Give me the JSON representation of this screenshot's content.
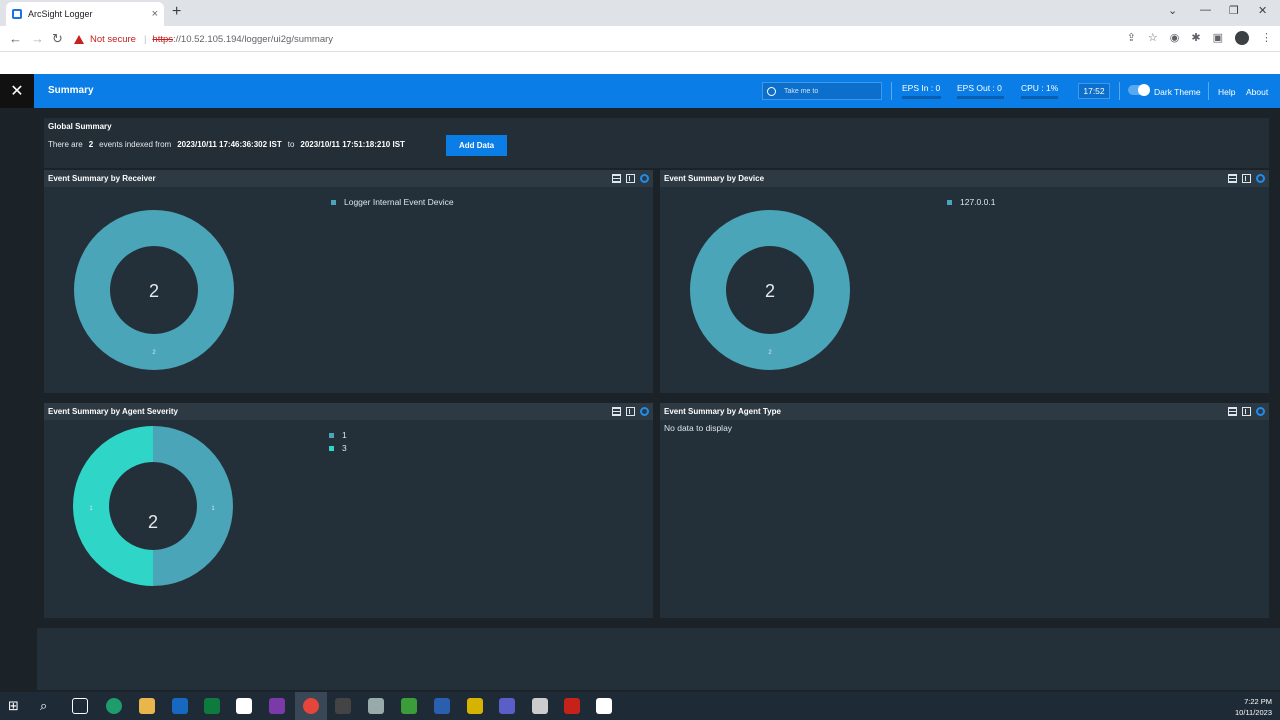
{
  "browser": {
    "tab_title": "ArcSight Logger",
    "tab_close": "×",
    "new_tab": "+",
    "security_label": "Not secure",
    "url_scheme": "https",
    "url_rest": "://10.52.105.194/logger/ui2g/summary"
  },
  "header": {
    "logo_glyph": "✕",
    "title": "Summary",
    "search_placeholder": "Take me to",
    "eps_in": "EPS In : 0",
    "eps_out": "EPS Out : 0",
    "cpu": "CPU : 1%",
    "time": "17:52",
    "theme_label": "Dark Theme",
    "help": "Help",
    "about": "About"
  },
  "global_summary": {
    "title": "Global Summary",
    "prefix": "There are",
    "count": "2",
    "middle": "events indexed from",
    "from": "2023/10/11 17:46:36:302 IST",
    "to_word": "to",
    "to": "2023/10/11 17:51:18:210 IST",
    "add_button": "Add Data"
  },
  "panels": {
    "receiver": {
      "title": "Event Summary by Receiver",
      "total": "2",
      "legend": [
        "Logger Internal Event Device"
      ],
      "slice_label": "2"
    },
    "device": {
      "title": "Event Summary by Device",
      "total": "2",
      "legend": [
        "127.0.0.1"
      ],
      "slice_label": "2"
    },
    "severity": {
      "title": "Event Summary by Agent Severity",
      "total": "2",
      "legend": [
        "1",
        "3"
      ],
      "left_label": "1",
      "right_label": "1"
    },
    "agent_type": {
      "title": "Event Summary by Agent Type",
      "empty_text": "No data to display"
    }
  },
  "taskbar": {
    "time": "7:22 PM",
    "date": "10/11/2023"
  },
  "colors": {
    "accent": "#0a7ee6",
    "donut_primary": "#4aa5b8",
    "donut_secondary": "#2fd6c7",
    "panel_bg": "#243039"
  }
}
